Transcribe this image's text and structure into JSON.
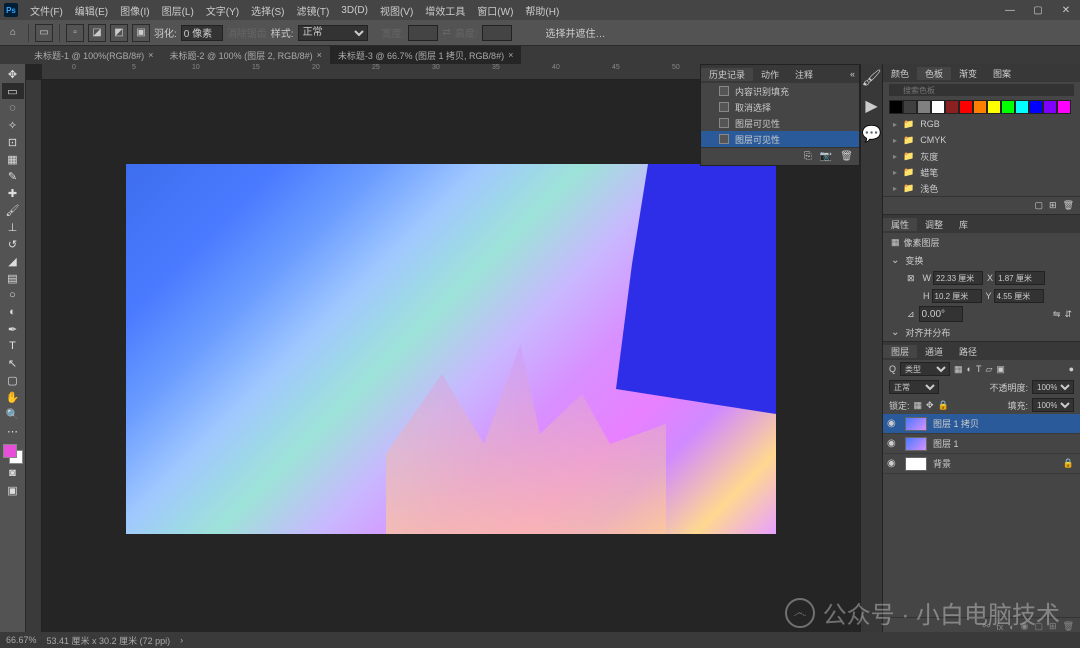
{
  "menubar": {
    "items": [
      "文件(F)",
      "编辑(E)",
      "图像(I)",
      "图层(L)",
      "文字(Y)",
      "选择(S)",
      "滤镜(T)",
      "3D(D)",
      "视图(V)",
      "增效工具",
      "窗口(W)",
      "帮助(H)"
    ]
  },
  "optionbar": {
    "feather_label": "羽化:",
    "feather_value": "0 像素",
    "style_label": "样式:",
    "style_value": "正常",
    "select_mask": "选择并遮住…"
  },
  "tabs": [
    {
      "label": "未标题-1 @ 100%(RGB/8#)",
      "active": false
    },
    {
      "label": "未标题-2 @ 100% (图层 2, RGB/8#)",
      "active": false
    },
    {
      "label": "未标题-3 @ 66.7% (图层 1 拷贝, RGB/8#)",
      "active": true
    }
  ],
  "history": {
    "tabs": [
      "历史记录",
      "动作",
      "注释"
    ],
    "items": [
      {
        "label": "内容识别填充"
      },
      {
        "label": "取消选择"
      },
      {
        "label": "图层可见性"
      },
      {
        "label": "图层可见性",
        "selected": true
      }
    ]
  },
  "swatches": {
    "tabs": [
      "颜色",
      "色板",
      "渐变",
      "图案"
    ],
    "search_placeholder": "搜索色板",
    "colors": [
      "#000000",
      "#404040",
      "#808080",
      "#ffffff",
      "#8b2020",
      "#ff0000",
      "#ff8000",
      "#ffff00",
      "#00ff00",
      "#00ffff",
      "#0000ff",
      "#8000ff",
      "#ff00ff"
    ],
    "folders": [
      "RGB",
      "CMYK",
      "灰度",
      "蜡笔",
      "浅色"
    ]
  },
  "properties": {
    "tabs": [
      "属性",
      "调整",
      "库"
    ],
    "type_label": "像素图层",
    "transform_label": "变换",
    "W": "22.33 厘米",
    "X": "1.87 厘米",
    "H": "10.2 厘米",
    "Y": "4.55 厘米",
    "angle": "0.00°",
    "align_label": "对齐并分布"
  },
  "layers": {
    "tabs": [
      "图层",
      "通道",
      "路径"
    ],
    "filter_label": "类型",
    "blend_mode": "正常",
    "opacity_label": "不透明度:",
    "opacity_value": "100%",
    "lock_label": "锁定:",
    "fill_label": "填充:",
    "fill_value": "100%",
    "items": [
      {
        "name": "图层 1 拷贝",
        "selected": true,
        "thumb": "linear-gradient(135deg,#4a7aff,#d890ff)"
      },
      {
        "name": "图层 1",
        "selected": false,
        "thumb": "linear-gradient(135deg,#4a7aff,#d890ff)"
      },
      {
        "name": "背景",
        "selected": false,
        "thumb": "#ffffff",
        "locked": true
      }
    ]
  },
  "status": {
    "zoom": "66.67%",
    "dims": "53.41 厘米 x 30.2 厘米 (72 ppi)"
  },
  "watermark": "公众号 · 小白电脑技术"
}
